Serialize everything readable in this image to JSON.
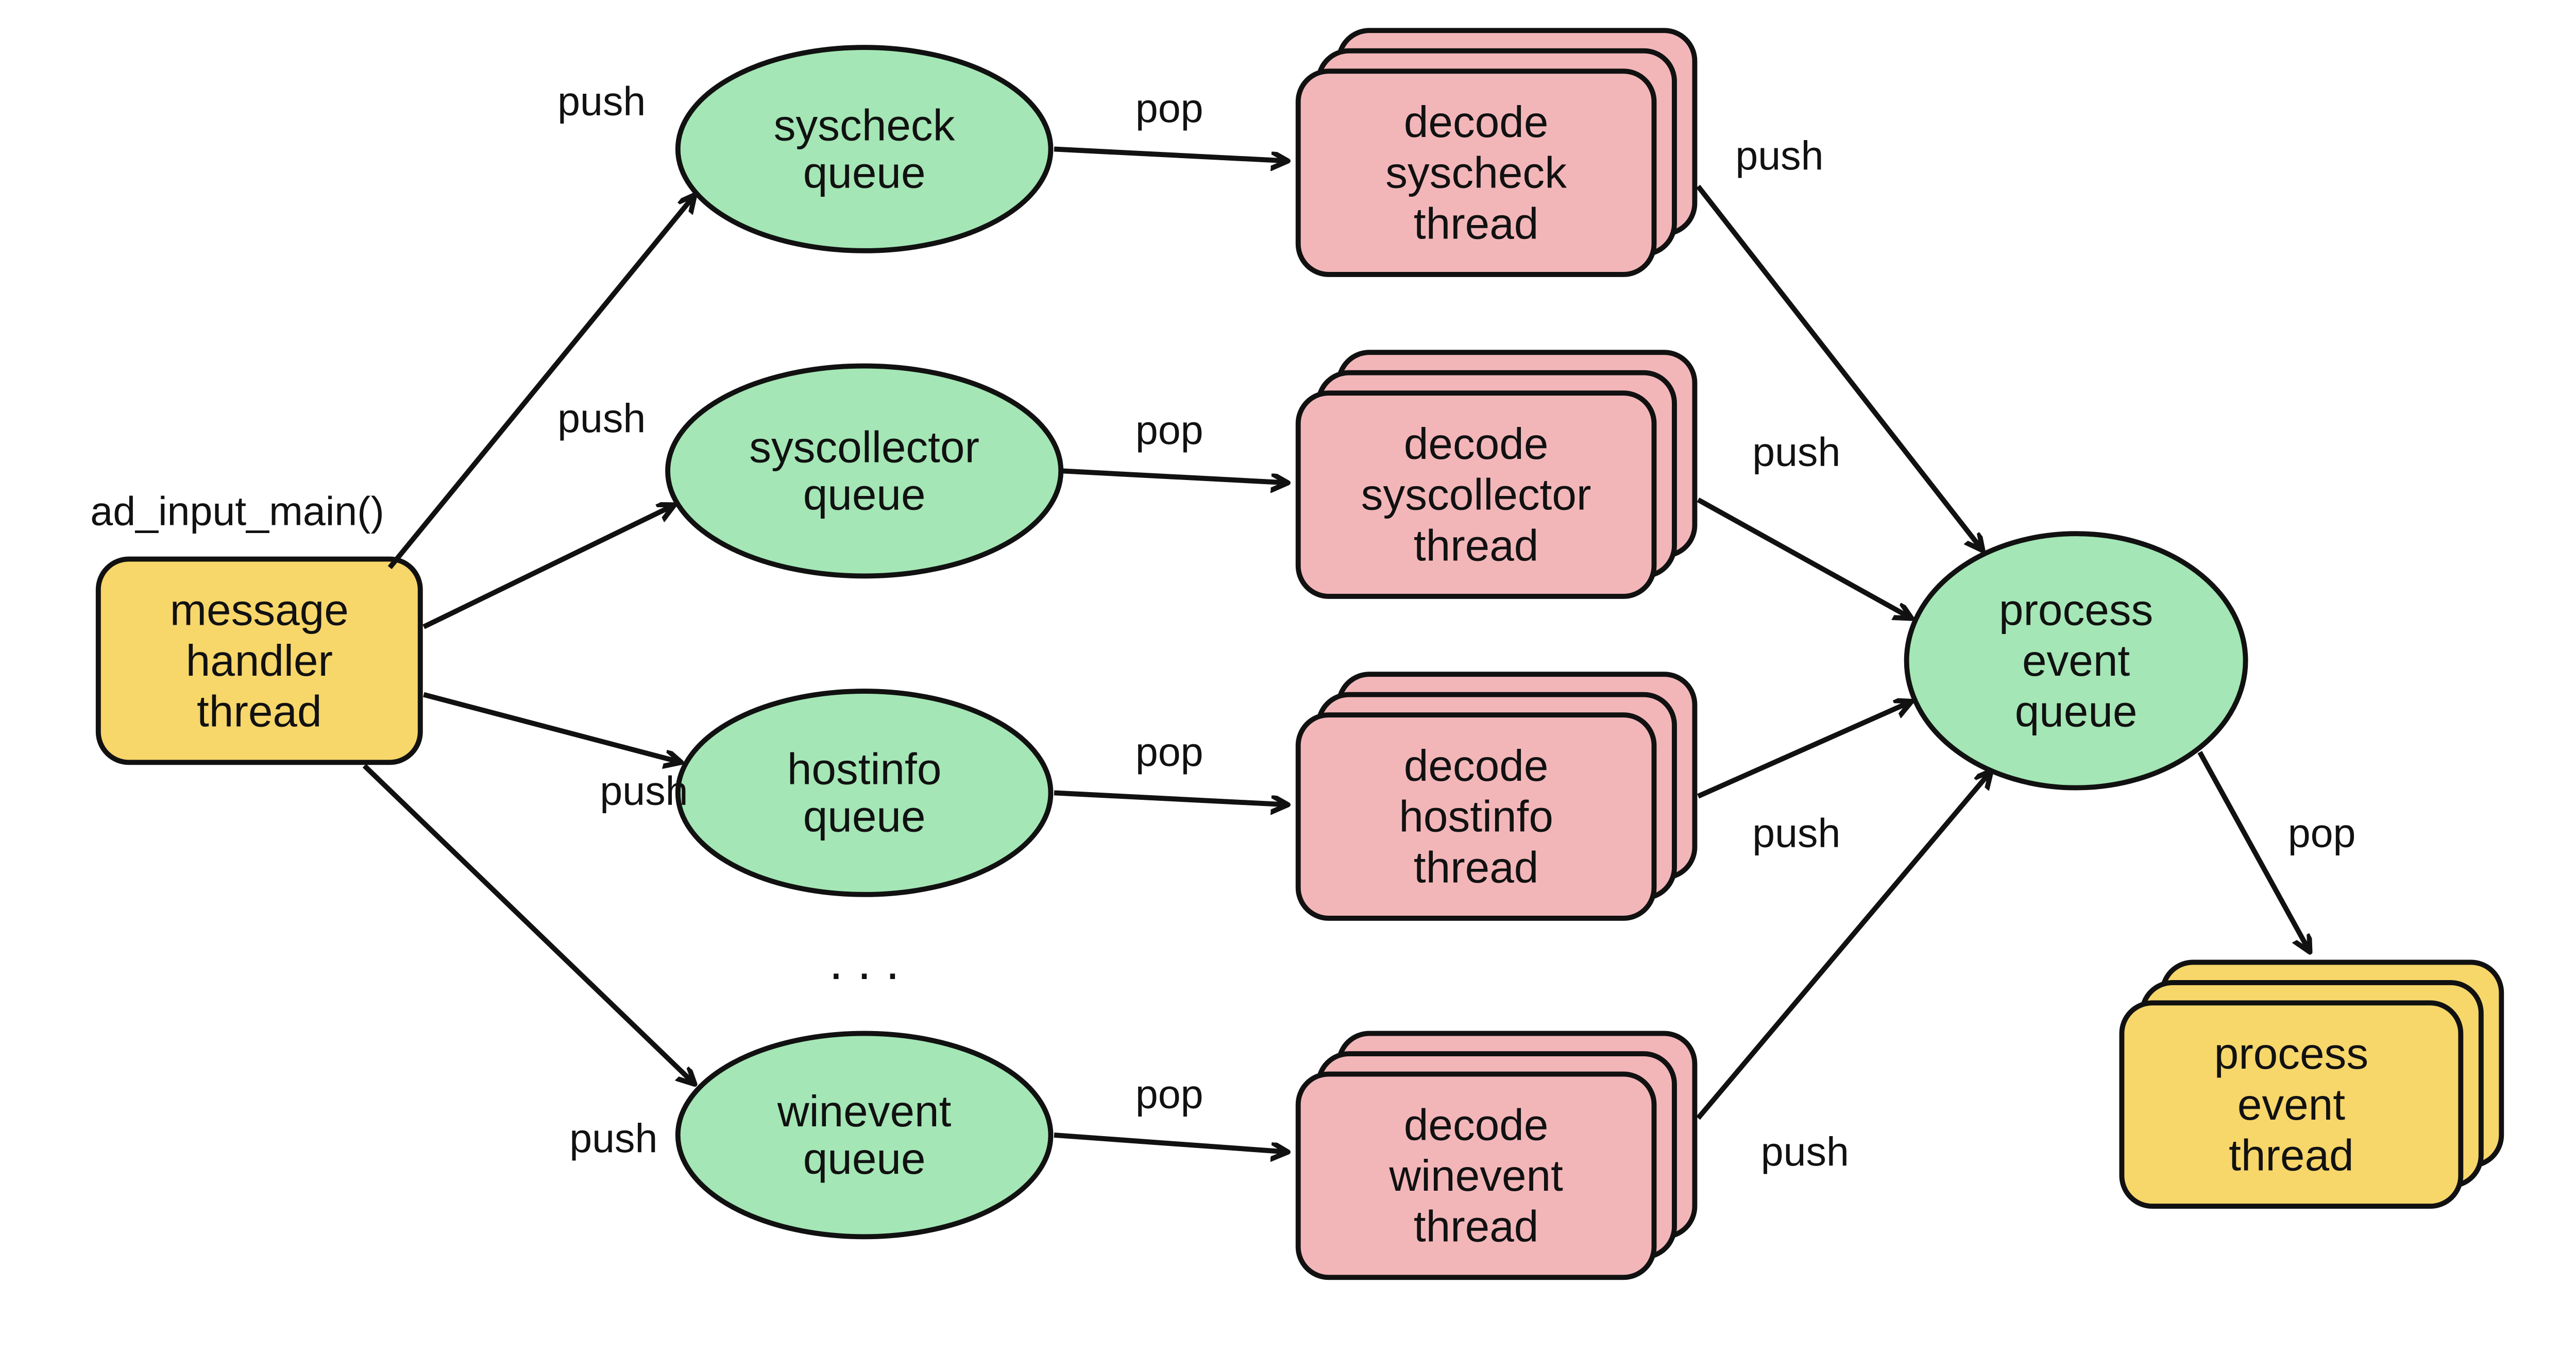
{
  "diagram": {
    "notation_label": "ad_input_main()",
    "ellipsis": ". . .",
    "nodes": {
      "msg_handler": {
        "lines": [
          "message",
          "handler",
          "thread"
        ]
      },
      "syscheck_q": {
        "lines": [
          "syscheck",
          "queue"
        ]
      },
      "syscollector_q": {
        "lines": [
          "syscollector",
          "queue"
        ]
      },
      "hostinfo_q": {
        "lines": [
          "hostinfo",
          "queue"
        ]
      },
      "winevent_q": {
        "lines": [
          "winevent",
          "queue"
        ]
      },
      "decode_syscheck": {
        "lines": [
          "decode",
          "syscheck",
          "thread"
        ]
      },
      "decode_syscollector": {
        "lines": [
          "decode",
          "syscollector",
          "thread"
        ]
      },
      "decode_hostinfo": {
        "lines": [
          "decode",
          "hostinfo",
          "thread"
        ]
      },
      "decode_winevent": {
        "lines": [
          "decode",
          "winevent",
          "thread"
        ]
      },
      "process_event_q": {
        "lines": [
          "process",
          "event",
          "queue"
        ]
      },
      "process_event_thread": {
        "lines": [
          "process",
          "event",
          "thread"
        ]
      }
    },
    "edge_labels": {
      "push": "push",
      "pop": "pop"
    },
    "colors": {
      "yellow": "#f7d66a",
      "green": "#a4e6b5",
      "pink": "#f2b6b9",
      "stroke": "#111111"
    }
  }
}
